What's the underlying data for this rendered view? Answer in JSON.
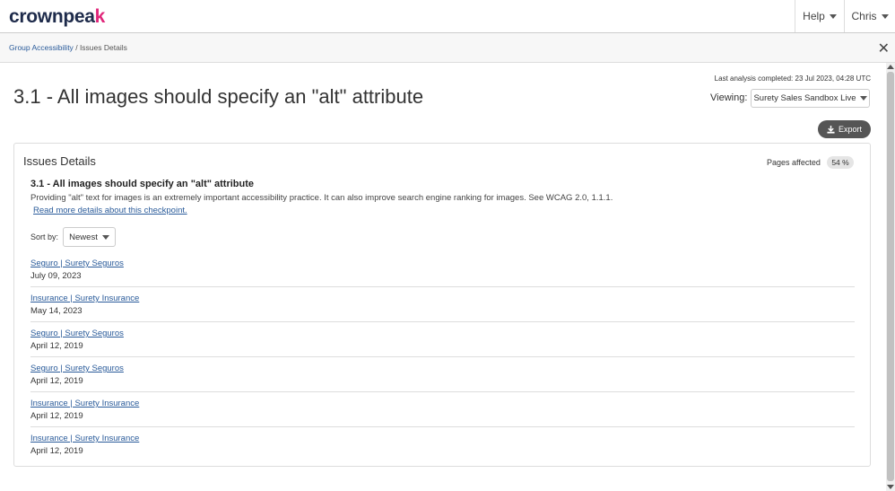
{
  "brand": {
    "logo_text": "crownpea",
    "logo_accent": "k"
  },
  "nav": {
    "help_label": "Help",
    "user_label": "Chris"
  },
  "breadcrumb": {
    "parent": "Group Accessibility",
    "separator": "/",
    "current": "Issues Details"
  },
  "header": {
    "last_analysis": "Last analysis completed: 23 Jul 2023, 04:28 UTC",
    "title": "3.1 - All images should specify an \"alt\" attribute",
    "viewing_label": "Viewing:",
    "viewing_value": "Surety Sales Sandbox Live",
    "export_label": "Export"
  },
  "panel": {
    "title": "Issues Details",
    "pages_affected_label": "Pages affected",
    "pages_affected_value": "54 %",
    "checkpoint_title": "3.1 - All images should specify an \"alt\" attribute",
    "checkpoint_desc": "Providing \"alt\" text for images is an extremely important accessibility practice. It can also improve search engine ranking for images. See WCAG 2.0, 1.1.1.",
    "checkpoint_link": "Read more details about this checkpoint.",
    "sort_label": "Sort by:",
    "sort_value": "Newest"
  },
  "pages": [
    {
      "title": "Seguro | Surety Seguros",
      "date": "July 09, 2023"
    },
    {
      "title": "Insurance | Surety Insurance",
      "date": "May 14, 2023"
    },
    {
      "title": "Seguro | Surety Seguros",
      "date": "April 12, 2019"
    },
    {
      "title": "Seguro | Surety Seguros",
      "date": "April 12, 2019"
    },
    {
      "title": "Insurance | Surety Insurance",
      "date": "April 12, 2019"
    },
    {
      "title": "Insurance | Surety Insurance",
      "date": "April 12, 2019"
    }
  ],
  "colors": {
    "link": "#2a5b9a",
    "brand_dark": "#1e2b4b",
    "brand_accent": "#e0267a",
    "export_bg": "#555555"
  }
}
